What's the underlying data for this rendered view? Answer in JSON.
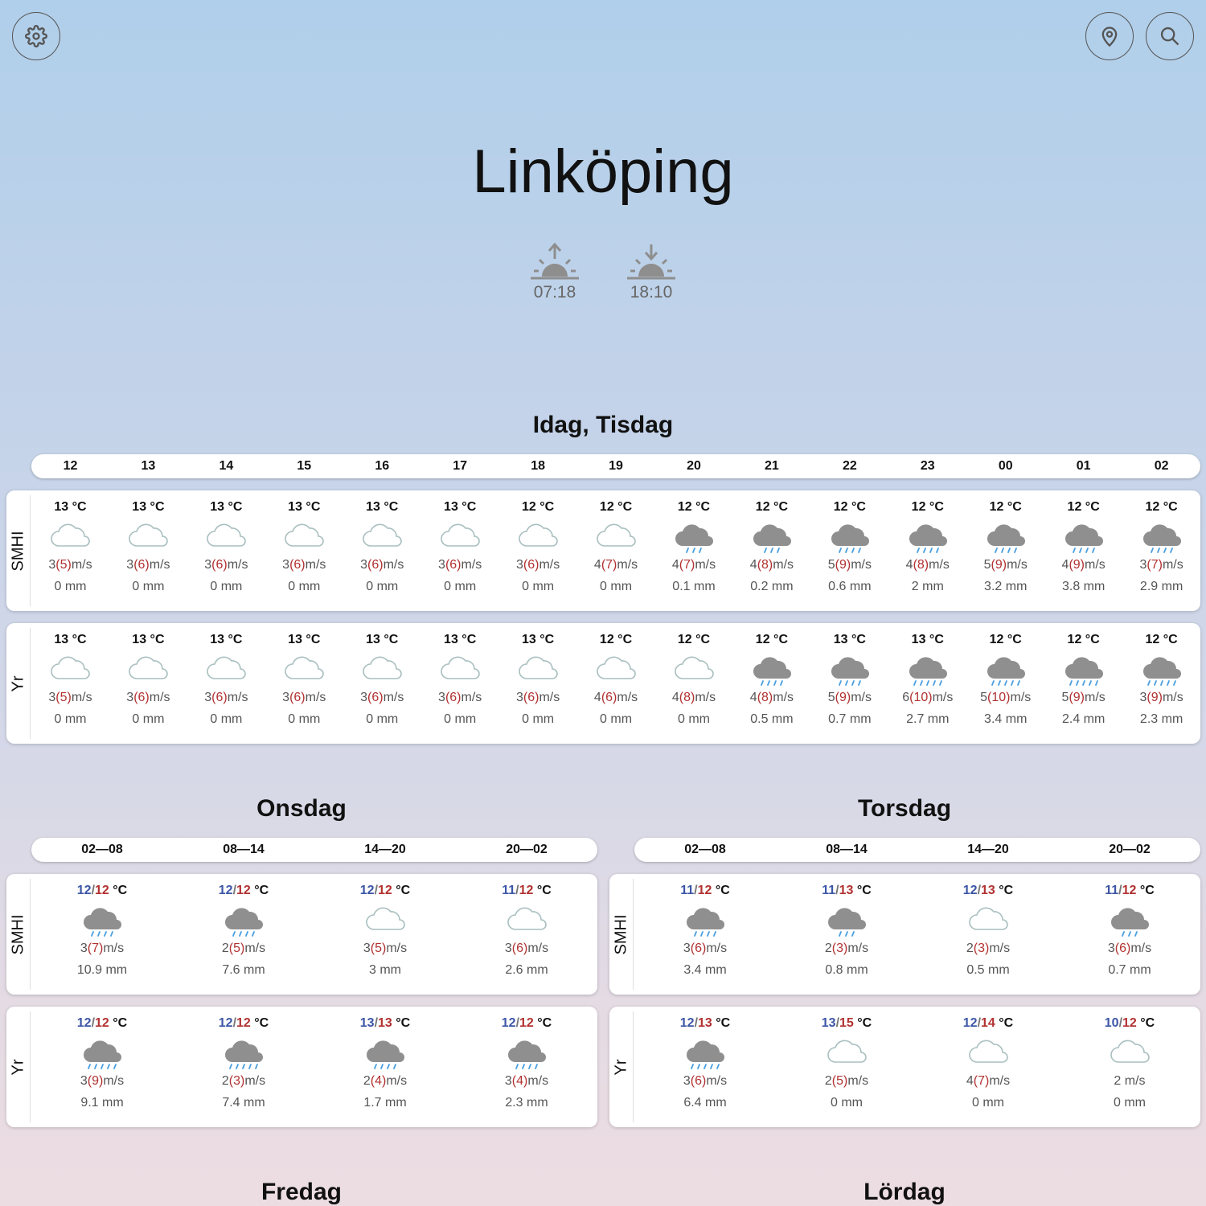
{
  "toolbar": {
    "settings_icon": "gear-icon",
    "location_icon": "map-pin-icon",
    "search_icon": "search-icon"
  },
  "city": "Linköping",
  "sun": {
    "sunrise": "07:18",
    "sunset": "18:10"
  },
  "colors": {
    "cloud_fill": "#8f8f8f",
    "cloud_outline": "#a9bfc0",
    "rain": "#4a9fe0",
    "gust": "#b23131",
    "temp_low": "#3c56a6",
    "temp_high": "#b23131"
  },
  "today": {
    "title": "Idag, Tisdag",
    "hours": [
      "12",
      "13",
      "14",
      "15",
      "16",
      "17",
      "18",
      "19",
      "20",
      "21",
      "22",
      "23",
      "00",
      "01",
      "02"
    ],
    "sources": [
      {
        "name": "SMHI",
        "cells": [
          {
            "temp": "13 °C",
            "icon": "cloud",
            "wind": "3",
            "gust": "(5)",
            "unit": "m/s",
            "precip": "0 mm"
          },
          {
            "temp": "13 °C",
            "icon": "cloud",
            "wind": "3",
            "gust": "(6)",
            "unit": "m/s",
            "precip": "0 mm"
          },
          {
            "temp": "13 °C",
            "icon": "cloud",
            "wind": "3",
            "gust": "(6)",
            "unit": "m/s",
            "precip": "0 mm"
          },
          {
            "temp": "13 °C",
            "icon": "cloud",
            "wind": "3",
            "gust": "(6)",
            "unit": "m/s",
            "precip": "0 mm"
          },
          {
            "temp": "13 °C",
            "icon": "cloud",
            "wind": "3",
            "gust": "(6)",
            "unit": "m/s",
            "precip": "0 mm"
          },
          {
            "temp": "13 °C",
            "icon": "cloud",
            "wind": "3",
            "gust": "(6)",
            "unit": "m/s",
            "precip": "0 mm"
          },
          {
            "temp": "12 °C",
            "icon": "cloud",
            "wind": "3",
            "gust": "(6)",
            "unit": "m/s",
            "precip": "0 mm"
          },
          {
            "temp": "12 °C",
            "icon": "cloud",
            "wind": "4",
            "gust": "(7)",
            "unit": "m/s",
            "precip": "0 mm"
          },
          {
            "temp": "12 °C",
            "icon": "rain-light",
            "wind": "4",
            "gust": "(7)",
            "unit": "m/s",
            "precip": "0.1 mm"
          },
          {
            "temp": "12 °C",
            "icon": "rain-light",
            "wind": "4",
            "gust": "(8)",
            "unit": "m/s",
            "precip": "0.2 mm"
          },
          {
            "temp": "12 °C",
            "icon": "rain",
            "wind": "5",
            "gust": "(9)",
            "unit": "m/s",
            "precip": "0.6 mm"
          },
          {
            "temp": "12 °C",
            "icon": "rain",
            "wind": "4",
            "gust": "(8)",
            "unit": "m/s",
            "precip": "2 mm"
          },
          {
            "temp": "12 °C",
            "icon": "rain",
            "wind": "5",
            "gust": "(9)",
            "unit": "m/s",
            "precip": "3.2 mm"
          },
          {
            "temp": "12 °C",
            "icon": "rain",
            "wind": "4",
            "gust": "(9)",
            "unit": "m/s",
            "precip": "3.8 mm"
          },
          {
            "temp": "12 °C",
            "icon": "rain",
            "wind": "3",
            "gust": "(7)",
            "unit": "m/s",
            "precip": "2.9 mm"
          }
        ]
      },
      {
        "name": "Yr",
        "cells": [
          {
            "temp": "13 °C",
            "icon": "cloud",
            "wind": "3",
            "gust": "(5)",
            "unit": "m/s",
            "precip": "0 mm"
          },
          {
            "temp": "13 °C",
            "icon": "cloud",
            "wind": "3",
            "gust": "(6)",
            "unit": "m/s",
            "precip": "0 mm"
          },
          {
            "temp": "13 °C",
            "icon": "cloud",
            "wind": "3",
            "gust": "(6)",
            "unit": "m/s",
            "precip": "0 mm"
          },
          {
            "temp": "13 °C",
            "icon": "cloud",
            "wind": "3",
            "gust": "(6)",
            "unit": "m/s",
            "precip": "0 mm"
          },
          {
            "temp": "13 °C",
            "icon": "cloud",
            "wind": "3",
            "gust": "(6)",
            "unit": "m/s",
            "precip": "0 mm"
          },
          {
            "temp": "13 °C",
            "icon": "cloud",
            "wind": "3",
            "gust": "(6)",
            "unit": "m/s",
            "precip": "0 mm"
          },
          {
            "temp": "13 °C",
            "icon": "cloud",
            "wind": "3",
            "gust": "(6)",
            "unit": "m/s",
            "precip": "0 mm"
          },
          {
            "temp": "12 °C",
            "icon": "cloud",
            "wind": "4",
            "gust": "(6)",
            "unit": "m/s",
            "precip": "0 mm"
          },
          {
            "temp": "12 °C",
            "icon": "cloud",
            "wind": "4",
            "gust": "(8)",
            "unit": "m/s",
            "precip": "0 mm"
          },
          {
            "temp": "12 °C",
            "icon": "rain",
            "wind": "4",
            "gust": "(8)",
            "unit": "m/s",
            "precip": "0.5 mm"
          },
          {
            "temp": "13 °C",
            "icon": "rain",
            "wind": "5",
            "gust": "(9)",
            "unit": "m/s",
            "precip": "0.7 mm"
          },
          {
            "temp": "13 °C",
            "icon": "rain-heavy",
            "wind": "6",
            "gust": "(10)",
            "unit": "m/s",
            "precip": "2.7 mm"
          },
          {
            "temp": "12 °C",
            "icon": "rain-heavy",
            "wind": "5",
            "gust": "(10)",
            "unit": "m/s",
            "precip": "3.4 mm"
          },
          {
            "temp": "12 °C",
            "icon": "rain-heavy",
            "wind": "5",
            "gust": "(9)",
            "unit": "m/s",
            "precip": "2.4 mm"
          },
          {
            "temp": "12 °C",
            "icon": "rain-heavy",
            "wind": "3",
            "gust": "(9)",
            "unit": "m/s",
            "precip": "2.3 mm"
          }
        ]
      }
    ]
  },
  "days": [
    {
      "title": "Onsdag",
      "periods": [
        "02—08",
        "08—14",
        "14—20",
        "20—02"
      ],
      "sources": [
        {
          "name": "SMHI",
          "cells": [
            {
              "lo": "12",
              "hi": "12",
              "unit": "°C",
              "icon": "rain",
              "wind": "3",
              "gust": "(7)",
              "wunit": "m/s",
              "precip": "10.9 mm"
            },
            {
              "lo": "12",
              "hi": "12",
              "unit": "°C",
              "icon": "rain",
              "wind": "2",
              "gust": "(5)",
              "wunit": "m/s",
              "precip": "7.6 mm"
            },
            {
              "lo": "12",
              "hi": "12",
              "unit": "°C",
              "icon": "cloud",
              "wind": "3",
              "gust": "(5)",
              "wunit": "m/s",
              "precip": "3 mm"
            },
            {
              "lo": "11",
              "hi": "12",
              "unit": "°C",
              "icon": "cloud",
              "wind": "3",
              "gust": "(6)",
              "wunit": "m/s",
              "precip": "2.6 mm"
            }
          ]
        },
        {
          "name": "Yr",
          "cells": [
            {
              "lo": "12",
              "hi": "12",
              "unit": "°C",
              "icon": "rain-heavy",
              "wind": "3",
              "gust": "(9)",
              "wunit": "m/s",
              "precip": "9.1 mm"
            },
            {
              "lo": "12",
              "hi": "12",
              "unit": "°C",
              "icon": "rain-heavy",
              "wind": "2",
              "gust": "(3)",
              "wunit": "m/s",
              "precip": "7.4 mm"
            },
            {
              "lo": "13",
              "hi": "13",
              "unit": "°C",
              "icon": "rain",
              "wind": "2",
              "gust": "(4)",
              "wunit": "m/s",
              "precip": "1.7 mm"
            },
            {
              "lo": "12",
              "hi": "12",
              "unit": "°C",
              "icon": "rain",
              "wind": "3",
              "gust": "(4)",
              "wunit": "m/s",
              "precip": "2.3 mm"
            }
          ]
        }
      ]
    },
    {
      "title": "Torsdag",
      "periods": [
        "02—08",
        "08—14",
        "14—20",
        "20—02"
      ],
      "sources": [
        {
          "name": "SMHI",
          "cells": [
            {
              "lo": "11",
              "hi": "12",
              "unit": "°C",
              "icon": "rain",
              "wind": "3",
              "gust": "(6)",
              "wunit": "m/s",
              "precip": "3.4 mm"
            },
            {
              "lo": "11",
              "hi": "13",
              "unit": "°C",
              "icon": "rain-light",
              "wind": "2",
              "gust": "(3)",
              "wunit": "m/s",
              "precip": "0.8 mm"
            },
            {
              "lo": "12",
              "hi": "13",
              "unit": "°C",
              "icon": "cloud",
              "wind": "2",
              "gust": "(3)",
              "wunit": "m/s",
              "precip": "0.5 mm"
            },
            {
              "lo": "11",
              "hi": "12",
              "unit": "°C",
              "icon": "rain-light",
              "wind": "3",
              "gust": "(6)",
              "wunit": "m/s",
              "precip": "0.7 mm"
            }
          ]
        },
        {
          "name": "Yr",
          "cells": [
            {
              "lo": "12",
              "hi": "13",
              "unit": "°C",
              "icon": "rain-heavy",
              "wind": "3",
              "gust": "(6)",
              "wunit": "m/s",
              "precip": "6.4 mm"
            },
            {
              "lo": "13",
              "hi": "15",
              "unit": "°C",
              "icon": "cloud",
              "wind": "2",
              "gust": "(5)",
              "wunit": "m/s",
              "precip": "0 mm"
            },
            {
              "lo": "12",
              "hi": "14",
              "unit": "°C",
              "icon": "cloud",
              "wind": "4",
              "gust": "(7)",
              "wunit": "m/s",
              "precip": "0 mm"
            },
            {
              "lo": "10",
              "hi": "12",
              "unit": "°C",
              "icon": "cloud",
              "wind": "2",
              "gust": "",
              "wunit": "m/s",
              "precip": "0 mm"
            }
          ]
        }
      ]
    }
  ],
  "next_days": [
    "Fredag",
    "Lördag"
  ]
}
